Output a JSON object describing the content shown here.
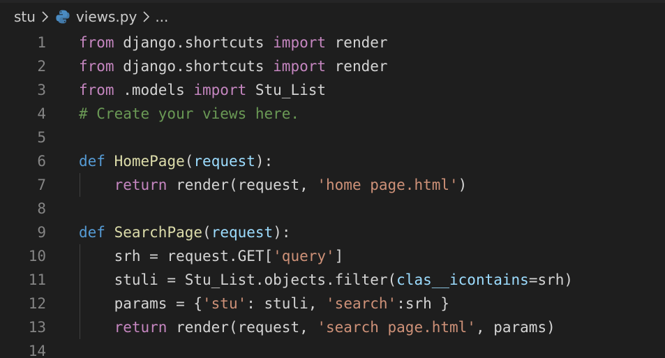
{
  "breadcrumb": {
    "folder": "stu",
    "file": "views.py",
    "more": "..."
  },
  "icons": {
    "separator": "chevron-right-icon",
    "file_type": "python-icon"
  },
  "colors": {
    "background": "#1e1e1e",
    "line_number": "#858585",
    "keyword_control": "#c586c0",
    "keyword_def": "#569cd6",
    "function": "#dcdcaa",
    "parameter": "#9cdcfe",
    "string": "#ce9178",
    "comment": "#6a9955",
    "text": "#d4d4d4"
  },
  "code": {
    "lines": [
      {
        "number": "1",
        "tokens": [
          {
            "t": "from",
            "c": "kw-ctrl"
          },
          {
            "t": " django.shortcuts ",
            "c": "plain"
          },
          {
            "t": "import",
            "c": "kw-ctrl"
          },
          {
            "t": " render",
            "c": "plain"
          }
        ]
      },
      {
        "number": "2",
        "tokens": [
          {
            "t": "from",
            "c": "kw-ctrl"
          },
          {
            "t": " django.shortcuts ",
            "c": "plain"
          },
          {
            "t": "import",
            "c": "kw-ctrl"
          },
          {
            "t": " render",
            "c": "plain"
          }
        ]
      },
      {
        "number": "3",
        "tokens": [
          {
            "t": "from",
            "c": "kw-ctrl"
          },
          {
            "t": " .models ",
            "c": "plain"
          },
          {
            "t": "import",
            "c": "kw-ctrl"
          },
          {
            "t": " Stu_List",
            "c": "plain"
          }
        ]
      },
      {
        "number": "4",
        "tokens": [
          {
            "t": "# Create your views here.",
            "c": "cmt"
          }
        ]
      },
      {
        "number": "5",
        "tokens": []
      },
      {
        "number": "6",
        "tokens": [
          {
            "t": "def",
            "c": "kw-def"
          },
          {
            "t": " ",
            "c": "plain"
          },
          {
            "t": "HomePage",
            "c": "fn"
          },
          {
            "t": "(",
            "c": "plain"
          },
          {
            "t": "request",
            "c": "param"
          },
          {
            "t": "):",
            "c": "plain"
          }
        ]
      },
      {
        "number": "7",
        "guide": true,
        "tokens": [
          {
            "t": "    ",
            "c": "plain"
          },
          {
            "t": "return",
            "c": "kw-ctrl"
          },
          {
            "t": " render(request, ",
            "c": "plain"
          },
          {
            "t": "'home page.html'",
            "c": "str"
          },
          {
            "t": ")",
            "c": "plain"
          }
        ]
      },
      {
        "number": "8",
        "tokens": []
      },
      {
        "number": "9",
        "tokens": [
          {
            "t": "def",
            "c": "kw-def"
          },
          {
            "t": " ",
            "c": "plain"
          },
          {
            "t": "SearchPage",
            "c": "fn"
          },
          {
            "t": "(",
            "c": "plain"
          },
          {
            "t": "request",
            "c": "param"
          },
          {
            "t": "):",
            "c": "plain"
          }
        ]
      },
      {
        "number": "10",
        "guide": true,
        "tokens": [
          {
            "t": "    srh = request.GET[",
            "c": "plain"
          },
          {
            "t": "'query'",
            "c": "str"
          },
          {
            "t": "]",
            "c": "plain"
          }
        ]
      },
      {
        "number": "11",
        "guide": true,
        "tokens": [
          {
            "t": "    stuli = Stu_List.objects.filter(",
            "c": "plain"
          },
          {
            "t": "clas__icontains",
            "c": "param"
          },
          {
            "t": "=srh)",
            "c": "plain"
          }
        ]
      },
      {
        "number": "12",
        "guide": true,
        "tokens": [
          {
            "t": "    params = {",
            "c": "plain"
          },
          {
            "t": "'stu'",
            "c": "str"
          },
          {
            "t": ": stuli, ",
            "c": "plain"
          },
          {
            "t": "'search'",
            "c": "str"
          },
          {
            "t": ":srh }",
            "c": "plain"
          }
        ]
      },
      {
        "number": "13",
        "guide": true,
        "tokens": [
          {
            "t": "    ",
            "c": "plain"
          },
          {
            "t": "return",
            "c": "kw-ctrl"
          },
          {
            "t": " render(request, ",
            "c": "plain"
          },
          {
            "t": "'search page.html'",
            "c": "str"
          },
          {
            "t": ", params)",
            "c": "plain"
          }
        ]
      },
      {
        "number": "14",
        "tokens": []
      }
    ]
  }
}
